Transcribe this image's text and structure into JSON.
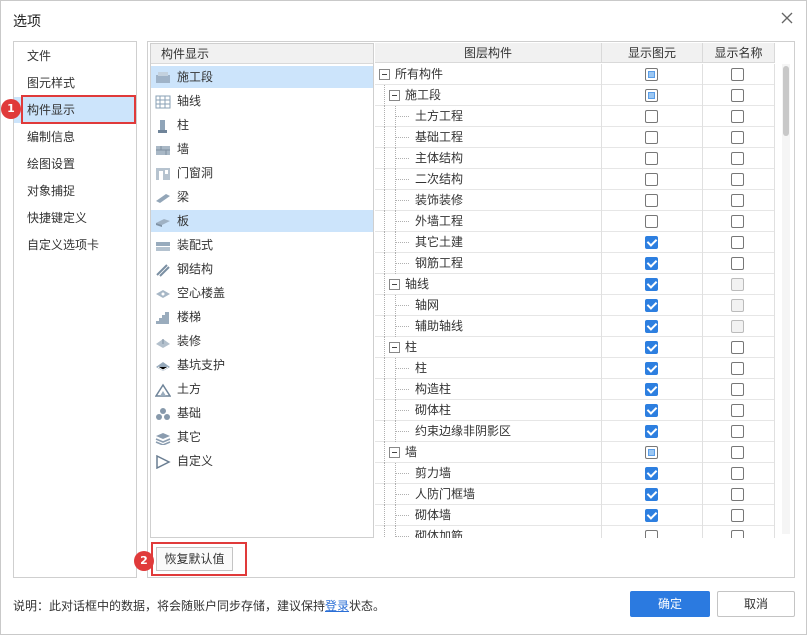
{
  "window": {
    "title": "选项"
  },
  "nav": {
    "items": [
      {
        "label": "文件",
        "active": false
      },
      {
        "label": "图元样式",
        "active": false
      },
      {
        "label": "构件显示",
        "active": true
      },
      {
        "label": "编制信息",
        "active": false
      },
      {
        "label": "绘图设置",
        "active": false
      },
      {
        "label": "对象捕捉",
        "active": false
      },
      {
        "label": "快捷键定义",
        "active": false
      },
      {
        "label": "自定义选项卡",
        "active": false
      }
    ]
  },
  "markers": {
    "m1": "1",
    "m2": "2"
  },
  "components": {
    "header": "构件显示",
    "items": [
      {
        "label": "施工段",
        "icon": "construction-section-icon",
        "selected": true
      },
      {
        "label": "轴线",
        "icon": "axis-grid-icon",
        "selected": false
      },
      {
        "label": "柱",
        "icon": "column-icon",
        "selected": false
      },
      {
        "label": "墙",
        "icon": "wall-icon",
        "selected": false
      },
      {
        "label": "门窗洞",
        "icon": "door-window-icon",
        "selected": false
      },
      {
        "label": "梁",
        "icon": "beam-icon",
        "selected": false
      },
      {
        "label": "板",
        "icon": "slab-icon",
        "selected": true
      },
      {
        "label": "装配式",
        "icon": "prefab-icon",
        "selected": false
      },
      {
        "label": "钢结构",
        "icon": "steel-structure-icon",
        "selected": false
      },
      {
        "label": "空心楼盖",
        "icon": "hollow-floor-icon",
        "selected": false
      },
      {
        "label": "楼梯",
        "icon": "stairs-icon",
        "selected": false
      },
      {
        "label": "装修",
        "icon": "decoration-icon",
        "selected": false
      },
      {
        "label": "基坑支护",
        "icon": "pit-support-icon",
        "selected": false
      },
      {
        "label": "土方",
        "icon": "earthwork-icon",
        "selected": false
      },
      {
        "label": "基础",
        "icon": "foundation-icon",
        "selected": false
      },
      {
        "label": "其它",
        "icon": "other-icon",
        "selected": false
      },
      {
        "label": "自定义",
        "icon": "custom-icon",
        "selected": false
      }
    ]
  },
  "table": {
    "headers": [
      "图层构件",
      "显示图元",
      "显示名称"
    ],
    "rows": [
      {
        "label": "所有构件",
        "level": 0,
        "expander": true,
        "show": "partial",
        "name": "unchecked"
      },
      {
        "label": "施工段",
        "level": 1,
        "expander": true,
        "show": "partial",
        "name": "unchecked"
      },
      {
        "label": "土方工程",
        "level": 2,
        "expander": false,
        "show": "unchecked",
        "name": "unchecked"
      },
      {
        "label": "基础工程",
        "level": 2,
        "expander": false,
        "show": "unchecked",
        "name": "unchecked"
      },
      {
        "label": "主体结构",
        "level": 2,
        "expander": false,
        "show": "unchecked",
        "name": "unchecked"
      },
      {
        "label": "二次结构",
        "level": 2,
        "expander": false,
        "show": "unchecked",
        "name": "unchecked"
      },
      {
        "label": "装饰装修",
        "level": 2,
        "expander": false,
        "show": "unchecked",
        "name": "unchecked"
      },
      {
        "label": "外墙工程",
        "level": 2,
        "expander": false,
        "show": "unchecked",
        "name": "unchecked"
      },
      {
        "label": "其它土建",
        "level": 2,
        "expander": false,
        "show": "checked",
        "name": "unchecked"
      },
      {
        "label": "钢筋工程",
        "level": 2,
        "expander": false,
        "show": "checked",
        "name": "unchecked"
      },
      {
        "label": "轴线",
        "level": 1,
        "expander": true,
        "show": "checked",
        "name": "disabled"
      },
      {
        "label": "轴网",
        "level": 2,
        "expander": false,
        "show": "checked",
        "name": "disabled"
      },
      {
        "label": "辅助轴线",
        "level": 2,
        "expander": false,
        "show": "checked",
        "name": "disabled"
      },
      {
        "label": "柱",
        "level": 1,
        "expander": true,
        "show": "checked",
        "name": "unchecked"
      },
      {
        "label": "柱",
        "level": 2,
        "expander": false,
        "show": "checked",
        "name": "unchecked"
      },
      {
        "label": "构造柱",
        "level": 2,
        "expander": false,
        "show": "checked",
        "name": "unchecked"
      },
      {
        "label": "砌体柱",
        "level": 2,
        "expander": false,
        "show": "checked",
        "name": "unchecked"
      },
      {
        "label": "约束边缘非阴影区",
        "level": 2,
        "expander": false,
        "show": "checked",
        "name": "unchecked"
      },
      {
        "label": "墙",
        "level": 1,
        "expander": true,
        "show": "partial",
        "name": "unchecked"
      },
      {
        "label": "剪力墙",
        "level": 2,
        "expander": false,
        "show": "checked",
        "name": "unchecked"
      },
      {
        "label": "人防门框墙",
        "level": 2,
        "expander": false,
        "show": "checked",
        "name": "unchecked"
      },
      {
        "label": "砌体墙",
        "level": 2,
        "expander": false,
        "show": "checked",
        "name": "unchecked"
      },
      {
        "label": "砌体加筋",
        "level": 2,
        "expander": false,
        "show": "unchecked",
        "name": "unchecked"
      }
    ]
  },
  "buttons": {
    "restore": "恢复默认值",
    "ok": "确定",
    "cancel": "取消"
  },
  "note": {
    "prefix": "说明：此对话框中的数据，将会随账户同步存储，建议保持",
    "link": "登录",
    "suffix": "状态。"
  },
  "colors": {
    "accent": "#2b7ae0",
    "selection": "#cce4fb",
    "marker": "#e03a3a"
  }
}
